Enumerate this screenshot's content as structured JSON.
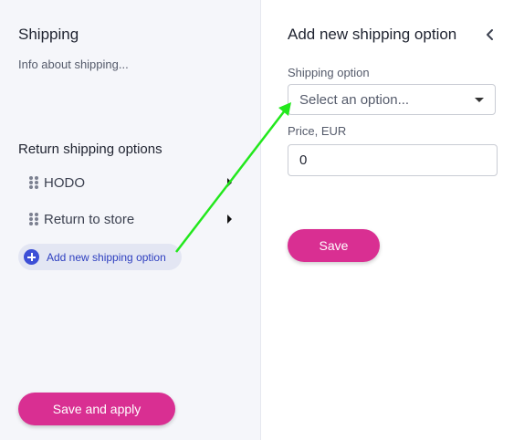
{
  "left_panel": {
    "title": "Shipping",
    "info": "Info about shipping...",
    "section_title": "Return shipping options",
    "options": [
      {
        "label": "HODO"
      },
      {
        "label": "Return to store"
      }
    ],
    "add_option_label": "Add new shipping option",
    "save_apply_label": "Save and apply"
  },
  "right_panel": {
    "title": "Add new shipping option",
    "shipping_option_label": "Shipping option",
    "shipping_option_placeholder": "Select an option...",
    "price_label": "Price, EUR",
    "price_value": "0",
    "save_label": "Save"
  },
  "icons": {
    "drag_handle": "drag-handle-icon",
    "expand": "caret-right-icon",
    "add": "plus-circle-icon",
    "back": "chevron-left-icon",
    "dropdown": "caret-down-icon"
  },
  "colors": {
    "accent": "#d92f92",
    "add_accent": "#3d4fd6",
    "annotation_arrow": "#22e81c"
  }
}
